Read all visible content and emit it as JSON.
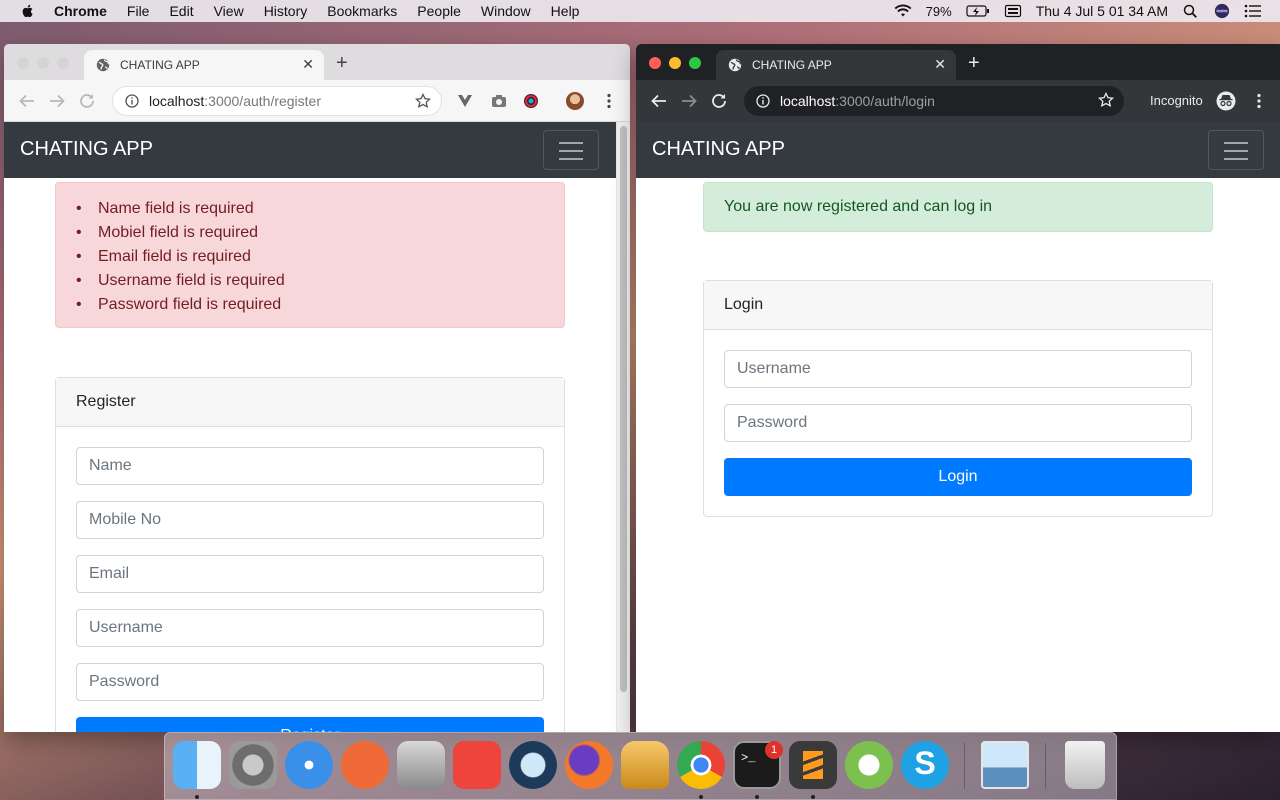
{
  "menubar": {
    "app_name": "Chrome",
    "items": [
      "File",
      "Edit",
      "View",
      "History",
      "Bookmarks",
      "People",
      "Window",
      "Help"
    ],
    "battery": "79%",
    "clock": "Thu 4 Jul  5 01 34 AM"
  },
  "left_window": {
    "tab_title": "CHATING APP",
    "url_host": "localhost",
    "url_rest": ":3000/auth/register",
    "brand": "CHATING APP",
    "errors": [
      "Name field is required",
      "Mobiel field is required",
      "Email field is required",
      "Username field is required",
      "Password field is required"
    ],
    "card_title": "Register",
    "fields": {
      "name": "Name",
      "mobile": "Mobile No",
      "email": "Email",
      "username": "Username",
      "password": "Password"
    },
    "submit_label": "Register"
  },
  "right_window": {
    "tab_title": "CHATING APP",
    "url_host": "localhost",
    "url_rest": ":3000/auth/login",
    "incognito_label": "Incognito",
    "brand": "CHATING APP",
    "success_message": "You are now registered and can log in",
    "card_title": "Login",
    "fields": {
      "username": "Username",
      "password": "Password"
    },
    "submit_label": "Login"
  },
  "dock": {
    "terminal_badge": "1",
    "apps": [
      "finder-icon",
      "system-preferences-icon",
      "safari-icon",
      "postman-icon",
      "disk-utility-icon",
      "anydesk-icon",
      "quicktime-icon",
      "firefox-icon",
      "sequel-pro-icon",
      "chrome-icon",
      "terminal-icon",
      "sublime-text-icon",
      "android-studio-icon",
      "skype-icon",
      "preview-icon",
      "trash-icon"
    ]
  }
}
